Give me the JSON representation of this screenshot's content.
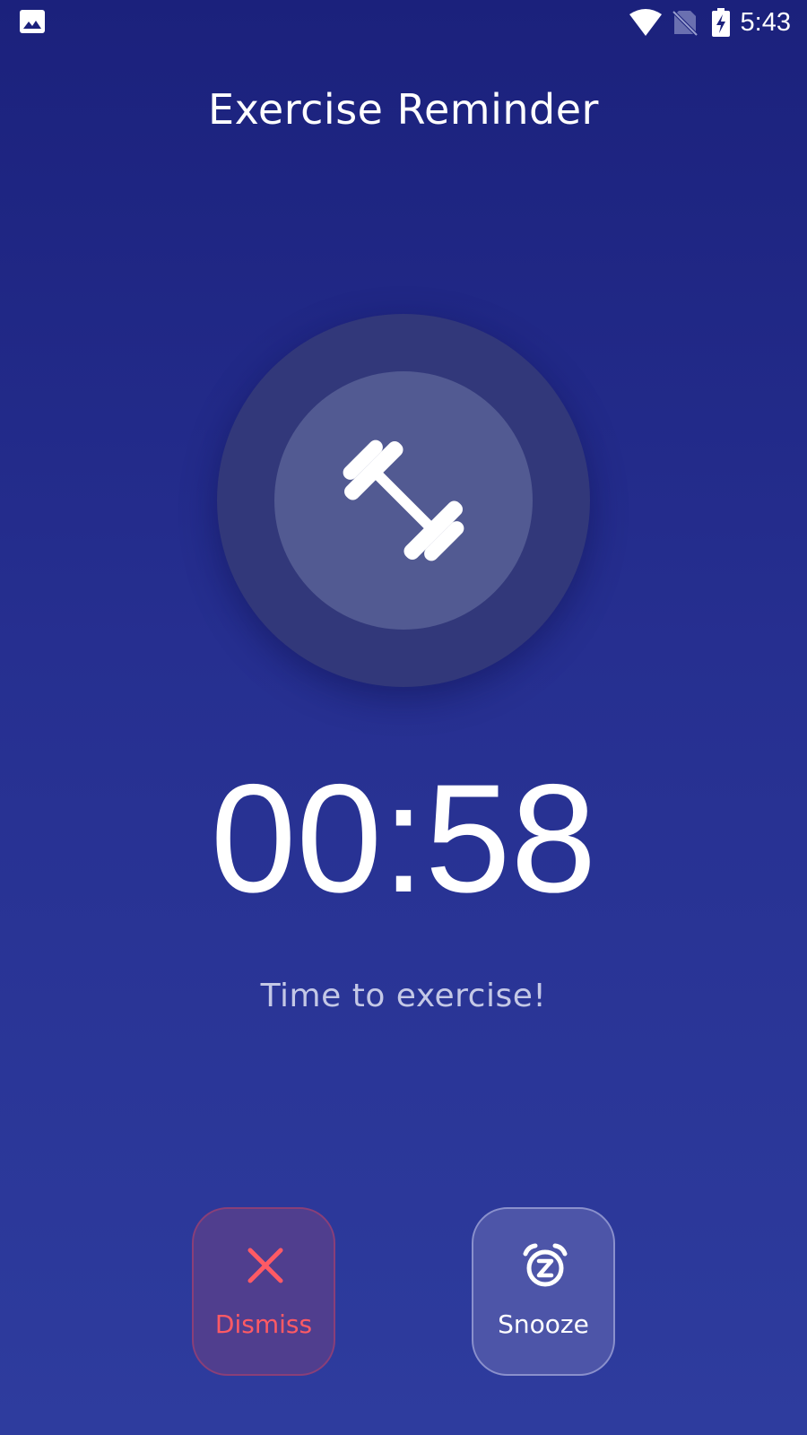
{
  "status_bar": {
    "time": "5:43",
    "icons": [
      "gallery-icon",
      "wifi-icon",
      "no-sim-icon",
      "battery-charging-icon"
    ]
  },
  "reminder": {
    "title": "Exercise Reminder",
    "icon": "dumbbell-icon",
    "countdown": "00:58",
    "message": "Time to exercise!"
  },
  "actions": {
    "dismiss": {
      "label": "Dismiss",
      "icon": "close-icon",
      "color": "#ff5a64"
    },
    "snooze": {
      "label": "Snooze",
      "icon": "snooze-alarm-icon",
      "color": "#ffffff"
    }
  },
  "colors": {
    "background_top": "#1b217c",
    "background_bottom": "#2e3c9e",
    "dismiss_accent": "#ff5a64"
  }
}
